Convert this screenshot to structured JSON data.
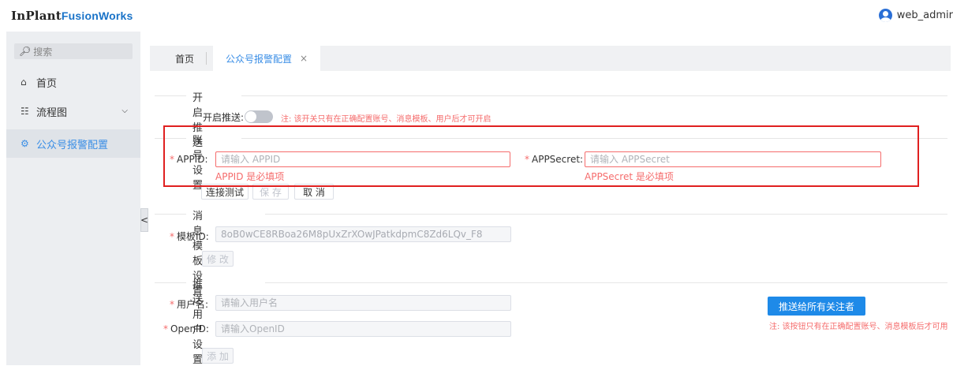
{
  "header": {
    "brand_inplant": "InPlant",
    "brand_fusionworks": "FusionWorks",
    "username": "web_admir"
  },
  "sidebar": {
    "search_placeholder": "搜索",
    "items": [
      {
        "label": "首页",
        "icon": "home-icon"
      },
      {
        "label": "流程图",
        "icon": "flowchart-icon"
      },
      {
        "label": "公众号报警配置",
        "icon": "gear-icon"
      }
    ]
  },
  "tabs": {
    "home": "首页",
    "active": "公众号报警配置",
    "close": "×"
  },
  "push_toggle": {
    "section_title": "开启推送",
    "label": "开启推送:",
    "enabled": false,
    "note": "注: 该开关只有在正确配置账号、消息模板、用户后才可开启"
  },
  "account": {
    "section_title": "账号设置",
    "appid_label": "APPID:",
    "appid_placeholder": "请输入 APPID",
    "appid_error": "APPID 是必填项",
    "appsecret_label": "APPSecret:",
    "appsecret_placeholder": "请输入 APPSecret",
    "appsecret_error": "APPSecret 是必填项",
    "test_button": "连接测试",
    "save_button": "保 存",
    "cancel_button": "取 消"
  },
  "template": {
    "section_title": "消息模板设置",
    "id_label": "模板ID:",
    "id_value": "8oB0wCE8RBoa26M8pUxZrXOwJPatkdpmC8Zd6LQv_F8",
    "edit_button": "修 改"
  },
  "users": {
    "section_title": "推送用户设置",
    "username_label": "用户名:",
    "username_placeholder": "请输入用户名",
    "openid_label": "OpenID:",
    "openid_placeholder": "请输入OpenID",
    "add_button": "添 加",
    "push_all_button": "推送给所有关注者",
    "push_all_note": "注: 该按钮只有在正确配置账号、消息模板后才可用"
  },
  "required_mark": "*",
  "colors": {
    "accent": "#3a8ee6",
    "error": "#f56c6c",
    "highlight_box": "#e02020",
    "primary_button": "#1e8ae8"
  }
}
